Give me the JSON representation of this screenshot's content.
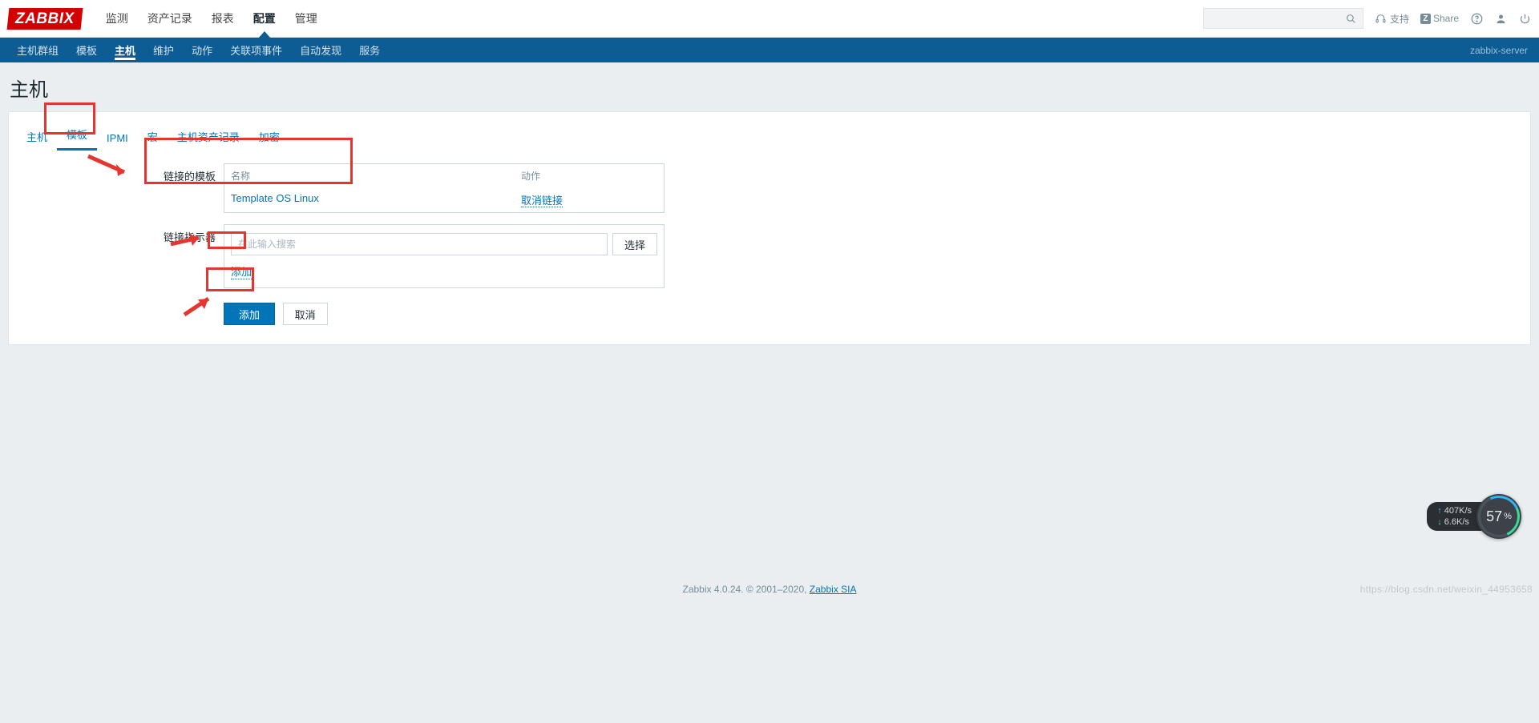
{
  "logo": "ZABBIX",
  "topnav": {
    "items": [
      "监测",
      "资产记录",
      "报表",
      "配置",
      "管理"
    ],
    "active_index": 3
  },
  "top_right": {
    "support": "支持",
    "share": "Share"
  },
  "subnav": {
    "items": [
      "主机群组",
      "模板",
      "主机",
      "维护",
      "动作",
      "关联项事件",
      "自动发现",
      "服务"
    ],
    "active_index": 2,
    "server": "zabbix-server"
  },
  "page_title": "主机",
  "tabs": {
    "items": [
      "主机",
      "模板",
      "IPMI",
      "宏",
      "主机资产记录",
      "加密"
    ],
    "active_index": 1
  },
  "form": {
    "linked_templates": {
      "label": "链接的模板",
      "name_header": "名称",
      "action_header": "动作",
      "rows": [
        {
          "name": "Template OS Linux",
          "unlink": "取消链接"
        }
      ]
    },
    "link_indicator": {
      "label": "链接指示器",
      "placeholder": "在此输入搜索",
      "select_btn": "选择",
      "add_link": "添加"
    },
    "actions": {
      "submit": "添加",
      "cancel": "取消"
    }
  },
  "footer": {
    "version": "Zabbix 4.0.24. © 2001–2020, ",
    "company": "Zabbix SIA"
  },
  "netwidget": {
    "up": "407K/s",
    "down": "6.6K/s",
    "percent": "57",
    "unit": "%"
  },
  "watermark": "https://blog.csdn.net/weixin_44953658"
}
